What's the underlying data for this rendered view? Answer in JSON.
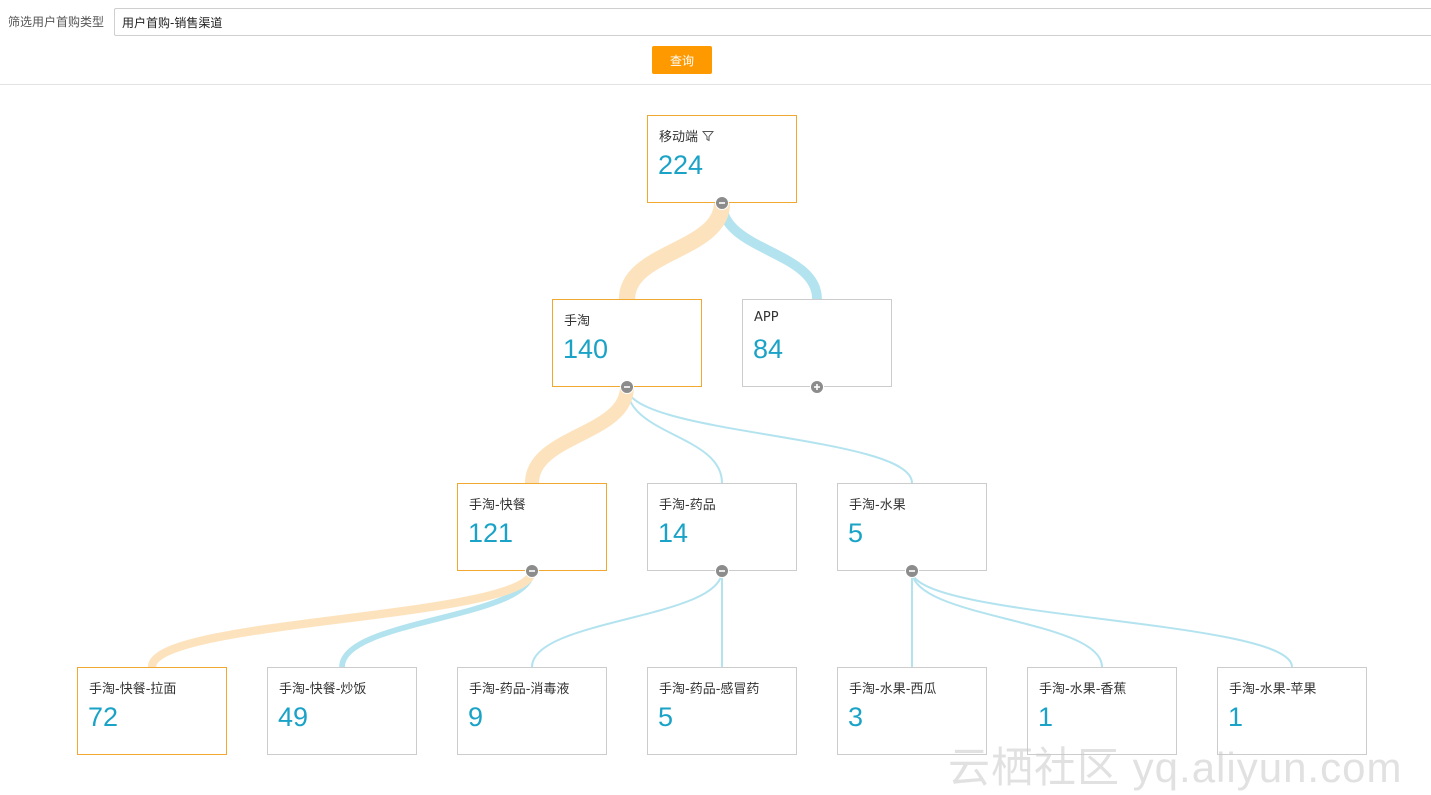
{
  "filter": {
    "label": "筛选用户首购类型",
    "value": "用户首购-销售渠道",
    "query_label": "查询"
  },
  "tree": {
    "nodes": [
      {
        "title": "移动端",
        "value": 224,
        "highlighted": true,
        "toggle": "collapse",
        "filter_icon": "funnel-icon"
      },
      {
        "title": "手淘",
        "value": 140,
        "highlighted": true,
        "toggle": "collapse"
      },
      {
        "title": "APP",
        "value": 84,
        "highlighted": false,
        "toggle": "expand"
      },
      {
        "title": "手淘-快餐",
        "value": 121,
        "highlighted": true,
        "toggle": "collapse"
      },
      {
        "title": "手淘-药品",
        "value": 14,
        "highlighted": false,
        "toggle": "collapse"
      },
      {
        "title": "手淘-水果",
        "value": 5,
        "highlighted": false,
        "toggle": "collapse"
      },
      {
        "title": "手淘-快餐-拉面",
        "value": 72,
        "highlighted": true
      },
      {
        "title": "手淘-快餐-炒饭",
        "value": 49,
        "highlighted": false
      },
      {
        "title": "手淘-药品-消毒液",
        "value": 9,
        "highlighted": false
      },
      {
        "title": "手淘-药品-感冒药",
        "value": 5,
        "highlighted": false
      },
      {
        "title": "手淘-水果-西瓜",
        "value": 3,
        "highlighted": false
      },
      {
        "title": "手淘-水果-香蕉",
        "value": 1,
        "highlighted": false
      },
      {
        "title": "手淘-水果-苹果",
        "value": 1,
        "highlighted": false
      }
    ]
  },
  "colors": {
    "highlight_link": "#fde3bd",
    "normal_link": "#b3e3ef",
    "highlight_border": "#f0a830",
    "value_text": "#1aa3c7",
    "query_button": "#ff9900"
  },
  "watermark": "云栖社区 yq.aliyun.com"
}
